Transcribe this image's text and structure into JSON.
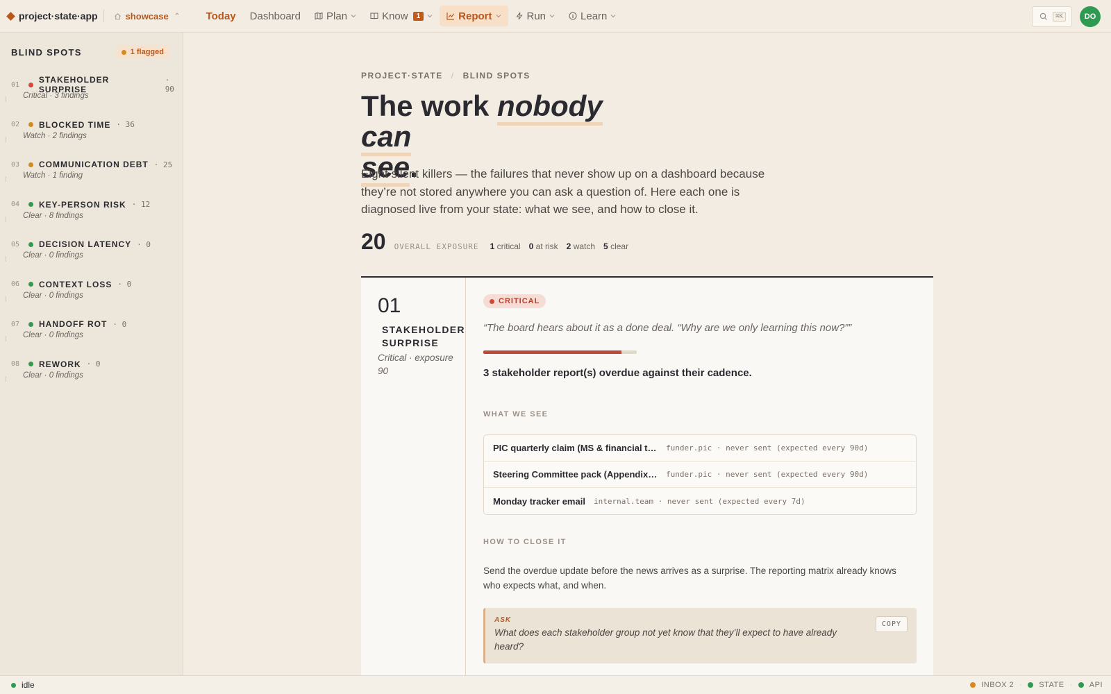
{
  "brand": {
    "name": "project·state·app"
  },
  "workspace": {
    "name": "showcase"
  },
  "nav": [
    {
      "label": "Today",
      "icon": "none"
    },
    {
      "label": "Dashboard",
      "icon": "none"
    },
    {
      "label": "Plan",
      "icon": "map-icon"
    },
    {
      "label": "Know",
      "icon": "book-icon",
      "badge": "1"
    },
    {
      "label": "Report",
      "icon": "chart-line-icon"
    },
    {
      "label": "Run",
      "icon": "bolt-icon"
    },
    {
      "label": "Learn",
      "icon": "info-icon"
    }
  ],
  "search": {
    "shortcut": "⌘K"
  },
  "user": {
    "initials": "DO"
  },
  "sidebar": {
    "title": "BLIND SPOTS",
    "flag_label": "1 flagged",
    "items": [
      {
        "num": "01",
        "name": "STAKEHOLDER SURPRISE",
        "score": "· 90",
        "sub": "Critical · 3 findings",
        "status": "critical"
      },
      {
        "num": "02",
        "name": "BLOCKED TIME",
        "score": "· 36",
        "sub": "Watch · 2 findings",
        "status": "watch"
      },
      {
        "num": "03",
        "name": "COMMUNICATION DEBT",
        "score": "· 25",
        "sub": "Watch · 1 finding",
        "status": "watch"
      },
      {
        "num": "04",
        "name": "KEY-PERSON RISK",
        "score": "· 12",
        "sub": "Clear · 8 findings",
        "status": "clear"
      },
      {
        "num": "05",
        "name": "DECISION LATENCY",
        "score": "· 0",
        "sub": "Clear · 0 findings",
        "status": "clear"
      },
      {
        "num": "06",
        "name": "CONTEXT LOSS",
        "score": "· 0",
        "sub": "Clear · 0 findings",
        "status": "clear"
      },
      {
        "num": "07",
        "name": "HANDOFF ROT",
        "score": "· 0",
        "sub": "Clear · 0 findings",
        "status": "clear"
      },
      {
        "num": "08",
        "name": "REWORK",
        "score": "· 0",
        "sub": "Clear · 0 findings",
        "status": "clear"
      }
    ]
  },
  "breadcrumb": {
    "root": "PROJECT·STATE",
    "sep": "/",
    "current": "BLIND SPOTS"
  },
  "hero": {
    "prefix": "The work ",
    "emphasis_a": "nobody can",
    "emphasis_b": "see",
    "suffix": "."
  },
  "lede": "Eight silent killers — the failures that never show up on a dashboard because they’re not stored anywhere you can ask a question of. Here each one is diagnosed live from your state: what we see, and how to close it.",
  "summary": {
    "exposure": "20",
    "exposure_label": "OVERALL EXPOSURE",
    "critical_n": "1",
    "critical_l": "critical",
    "risk_n": "0",
    "risk_l": "at risk",
    "watch_n": "2",
    "watch_l": "watch",
    "clear_n": "5",
    "clear_l": "clear"
  },
  "card": {
    "num": "01",
    "name_line1": "STAKEHOLDER",
    "name_line2": "SURPRISE",
    "meta": "Critical · exposure 90",
    "severity": "CRITICAL",
    "quote": "“The board hears about it as a done deal. “Why are we only learning this now?””",
    "exposure_fraction": 0.9,
    "headline": "3 stakeholder report(s) overdue against their cadence.",
    "see_label": "WHAT WE SEE",
    "findings": [
      {
        "title": "PIC quarterly claim (MS & financial tracker)",
        "meta": "funder.pic · never sent (expected every 90d)"
      },
      {
        "title": "Steering Committee pack (Appendix A)",
        "meta": "funder.pic · never sent (expected every 90d)"
      },
      {
        "title": "Monday tracker email",
        "meta": "internal.team · never sent (expected every 7d)"
      }
    ],
    "close_label": "HOW TO CLOSE IT",
    "howto": "Send the overdue update before the news arrives as a surprise. The reporting matrix already knows who expects what, and when.",
    "ask_label": "ASK",
    "ask_text": "What does each stakeholder group not yet know that they’ll expect to have already heard?",
    "copy_label": "COPY"
  },
  "status": {
    "state": "idle",
    "inbox": "INBOX 2",
    "state_label": "STATE",
    "api": "API"
  },
  "colors": {
    "critical": "#d0493a",
    "watch": "#d68a1e",
    "clear": "#2e9a52",
    "accent": "#b8581c"
  }
}
